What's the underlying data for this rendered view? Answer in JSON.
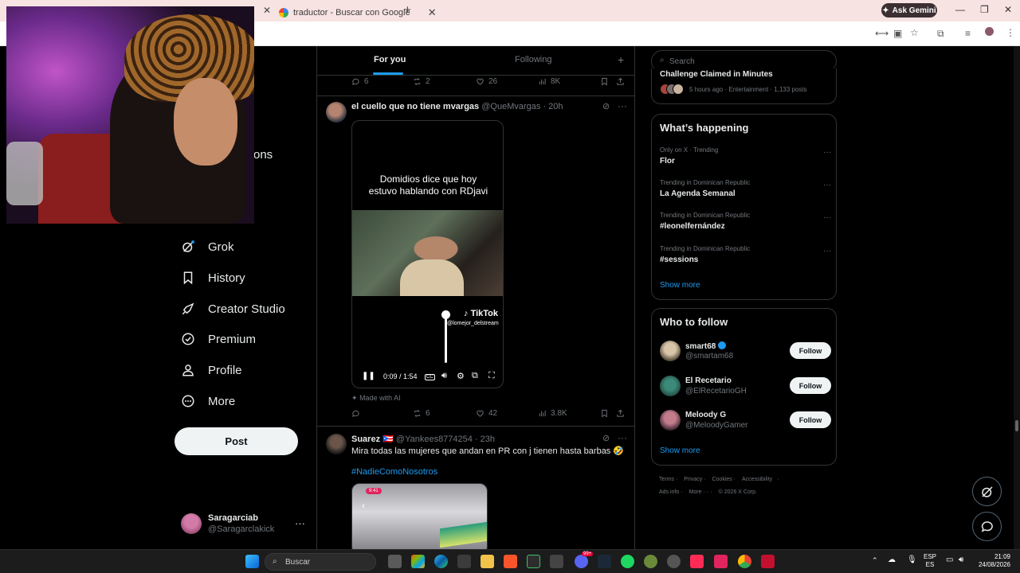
{
  "browser": {
    "tabs": [
      {
        "label": "traductor - Buscar con Google"
      }
    ],
    "new_tab_icon": "plus-icon",
    "ask_gemini": "Ask Gemini"
  },
  "nav": {
    "partial_label": "ons",
    "items": [
      {
        "label": "Grok",
        "icon": "grok-icon"
      },
      {
        "label": "History",
        "icon": "bookmark-icon"
      },
      {
        "label": "Creator Studio",
        "icon": "rocket-icon"
      },
      {
        "label": "Premium",
        "icon": "verified-badge-icon"
      },
      {
        "label": "Profile",
        "icon": "person-icon"
      },
      {
        "label": "More",
        "icon": "more-circle-icon"
      }
    ],
    "post_button": "Post",
    "account": {
      "name": "Saragarciab",
      "handle": "@Saragarclakick",
      "menu": "···"
    }
  },
  "feed": {
    "tabs": [
      {
        "label": "For you",
        "active": true
      },
      {
        "label": "Following",
        "active": false
      }
    ],
    "prev_actions": {
      "replies": "6",
      "reposts": "2",
      "likes": "26",
      "views": "8K"
    },
    "tweet1": {
      "name": "el cuello que no tiene mvargas",
      "handle": "@QueMvargas",
      "time": "· 20h",
      "video": {
        "caption_line1": "Domidios dice que hoy",
        "caption_line2": "estuvo hablando con RDjavi",
        "tiktok": "TikTok",
        "tiktok_user": "@lomejor_delstream",
        "time": "0:09 / 1:54",
        "volume_level": 1.0
      },
      "made_with_ai": "Made with AI",
      "actions": {
        "replies": "",
        "reposts": "6",
        "likes": "42",
        "views": "3.8K"
      }
    },
    "tweet2": {
      "name": "Suarez",
      "flag": "🇵🇷",
      "handle": "@Yankees8774254",
      "time": "· 23h",
      "text": "Mira todas las mujeres que andan en PR con j tienen hasta barbas 🤣",
      "hashtag": "#NadieComoNosotros",
      "media_time": "9:41"
    }
  },
  "sidebar": {
    "search_placeholder": "Search",
    "top_trend": {
      "title": "Challenge Claimed in Minutes",
      "meta": "5 hours ago · Entertainment · 1,133 posts"
    },
    "whats_happening": {
      "title": "What’s happening",
      "trends": [
        {
          "context": "Only on X · Trending",
          "name": "Flor"
        },
        {
          "context": "Trending in Dominican Republic",
          "name": "La Agenda Semanal"
        },
        {
          "context": "Trending in Dominican Republic",
          "name": "#leonelfernández"
        },
        {
          "context": "Trending in Dominican Republic",
          "name": "#sessions"
        }
      ],
      "show_more": "Show more"
    },
    "who_to_follow": {
      "title": "Who to follow",
      "accounts": [
        {
          "name": "smart68",
          "handle": "@smartam68",
          "verified": true,
          "button": "Follow"
        },
        {
          "name": "El Recetario",
          "handle": "@ElRecetarioGH",
          "verified": false,
          "button": "Follow"
        },
        {
          "name": "Meloody G",
          "handle": "@MeloodyGamer",
          "verified": false,
          "button": "Follow"
        }
      ],
      "show_more": "Show more"
    },
    "footer": {
      "row1": [
        "Terms",
        "Privacy",
        "Cookies",
        "Accessibility",
        "·"
      ],
      "row2": [
        "Ads info",
        "More ···",
        "© 2026 X Corp."
      ]
    }
  },
  "taskbar": {
    "search": "Buscar",
    "lang_top": "ESP",
    "lang_bottom": "ES",
    "time": "21:09",
    "date": "24/08/2026",
    "badge": "99+"
  },
  "colors": {
    "accent": "#1d9bf0",
    "bg": "#000000",
    "border": "#2f3336",
    "muted": "#71767b"
  }
}
